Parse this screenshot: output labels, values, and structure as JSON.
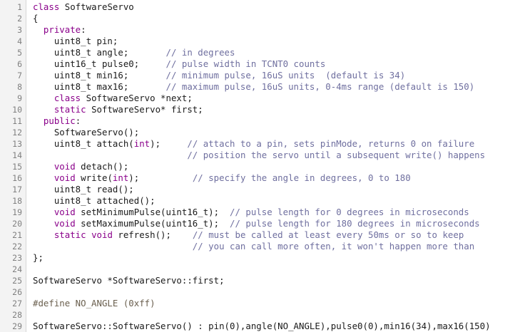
{
  "editor": {
    "lines": [
      {
        "n": "1",
        "segs": [
          [
            "kw",
            "class"
          ],
          [
            "p",
            " SoftwareServo"
          ]
        ]
      },
      {
        "n": "2",
        "segs": [
          [
            "p",
            "{"
          ]
        ]
      },
      {
        "n": "3",
        "segs": [
          [
            "p",
            "  "
          ],
          [
            "kw",
            "private"
          ],
          [
            "p",
            ":"
          ]
        ]
      },
      {
        "n": "4",
        "segs": [
          [
            "p",
            "    uint8_t pin;"
          ]
        ]
      },
      {
        "n": "5",
        "segs": [
          [
            "p",
            "    uint8_t angle;       "
          ],
          [
            "cm",
            "// in degrees"
          ]
        ]
      },
      {
        "n": "6",
        "segs": [
          [
            "p",
            "    uint16_t pulse0;     "
          ],
          [
            "cm",
            "// pulse width in TCNT0 counts"
          ]
        ]
      },
      {
        "n": "7",
        "segs": [
          [
            "p",
            "    uint8_t min16;       "
          ],
          [
            "cm",
            "// minimum pulse, 16uS units  (default is 34)"
          ]
        ]
      },
      {
        "n": "8",
        "segs": [
          [
            "p",
            "    uint8_t max16;       "
          ],
          [
            "cm",
            "// maximum pulse, 16uS units, 0-4ms range (default is 150)"
          ]
        ]
      },
      {
        "n": "9",
        "segs": [
          [
            "p",
            "    "
          ],
          [
            "kw",
            "class"
          ],
          [
            "p",
            " SoftwareServo *next;"
          ]
        ]
      },
      {
        "n": "10",
        "segs": [
          [
            "p",
            "    "
          ],
          [
            "kw",
            "static"
          ],
          [
            "p",
            " SoftwareServo* first;"
          ]
        ]
      },
      {
        "n": "11",
        "segs": [
          [
            "p",
            "  "
          ],
          [
            "kw",
            "public"
          ],
          [
            "p",
            ":"
          ]
        ]
      },
      {
        "n": "12",
        "segs": [
          [
            "p",
            "    SoftwareServo();"
          ]
        ]
      },
      {
        "n": "13",
        "segs": [
          [
            "p",
            "    uint8_t attach("
          ],
          [
            "kw",
            "int"
          ],
          [
            "p",
            ");     "
          ],
          [
            "cm",
            "// attach to a pin, sets pinMode, returns 0 on failure"
          ]
        ]
      },
      {
        "n": "14",
        "segs": [
          [
            "p",
            "                             "
          ],
          [
            "cm",
            "// position the servo until a subsequent write() happens"
          ]
        ]
      },
      {
        "n": "15",
        "segs": [
          [
            "p",
            "    "
          ],
          [
            "kw",
            "void"
          ],
          [
            "p",
            " detach();"
          ]
        ]
      },
      {
        "n": "16",
        "segs": [
          [
            "p",
            "    "
          ],
          [
            "kw",
            "void"
          ],
          [
            "p",
            " write("
          ],
          [
            "kw",
            "int"
          ],
          [
            "p",
            ");          "
          ],
          [
            "cm",
            "// specify the angle in degrees, 0 to 180"
          ]
        ]
      },
      {
        "n": "17",
        "segs": [
          [
            "p",
            "    uint8_t read();"
          ]
        ]
      },
      {
        "n": "18",
        "segs": [
          [
            "p",
            "    uint8_t attached();"
          ]
        ]
      },
      {
        "n": "19",
        "segs": [
          [
            "p",
            "    "
          ],
          [
            "kw",
            "void"
          ],
          [
            "p",
            " setMinimumPulse(uint16_t);  "
          ],
          [
            "cm",
            "// pulse length for 0 degrees in microseconds"
          ]
        ]
      },
      {
        "n": "20",
        "segs": [
          [
            "p",
            "    "
          ],
          [
            "kw",
            "void"
          ],
          [
            "p",
            " setMaximumPulse(uint16_t);  "
          ],
          [
            "cm",
            "// pulse length for 180 degrees in microseconds"
          ]
        ]
      },
      {
        "n": "21",
        "segs": [
          [
            "p",
            "    "
          ],
          [
            "kw",
            "static"
          ],
          [
            "p",
            " "
          ],
          [
            "kw",
            "void"
          ],
          [
            "p",
            " refresh();    "
          ],
          [
            "cm",
            "// must be called at least every 50ms or so to keep"
          ]
        ]
      },
      {
        "n": "22",
        "segs": [
          [
            "p",
            "                              "
          ],
          [
            "cm",
            "// you can call more often, it won't happen more than"
          ]
        ]
      },
      {
        "n": "23",
        "segs": [
          [
            "p",
            "};"
          ]
        ]
      },
      {
        "n": "24",
        "segs": []
      },
      {
        "n": "25",
        "segs": [
          [
            "p",
            "SoftwareServo *SoftwareServo::first;"
          ]
        ]
      },
      {
        "n": "26",
        "segs": []
      },
      {
        "n": "27",
        "segs": [
          [
            "pp",
            "#define NO_ANGLE (0xff)"
          ]
        ]
      },
      {
        "n": "28",
        "segs": []
      },
      {
        "n": "29",
        "segs": [
          [
            "p",
            "SoftwareServo::SoftwareServo() : pin(0),angle(NO_ANGLE),pulse0(0),min16(34),max16(150)"
          ]
        ]
      }
    ]
  }
}
